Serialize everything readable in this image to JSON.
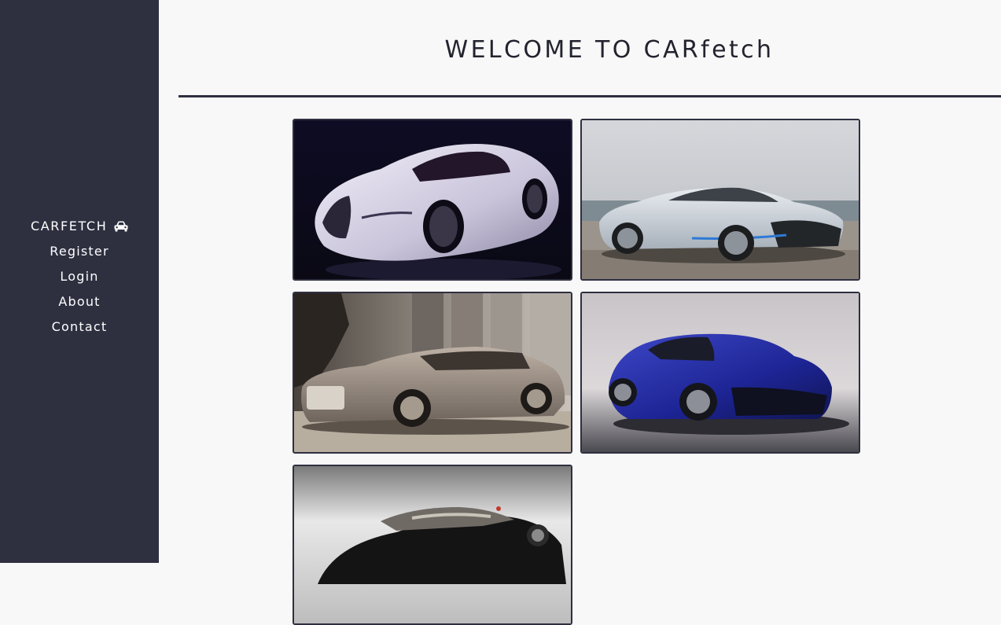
{
  "sidebar": {
    "brand_label": "CARFETCH",
    "items": [
      {
        "label": "Register"
      },
      {
        "label": "Login"
      },
      {
        "label": "About"
      },
      {
        "label": "Contact"
      }
    ]
  },
  "main": {
    "title": "WELCOME TO CARfetch"
  },
  "colors": {
    "sidebar_bg": "#2e3040",
    "page_bg": "#f8f8f8",
    "text": "#23232f"
  }
}
